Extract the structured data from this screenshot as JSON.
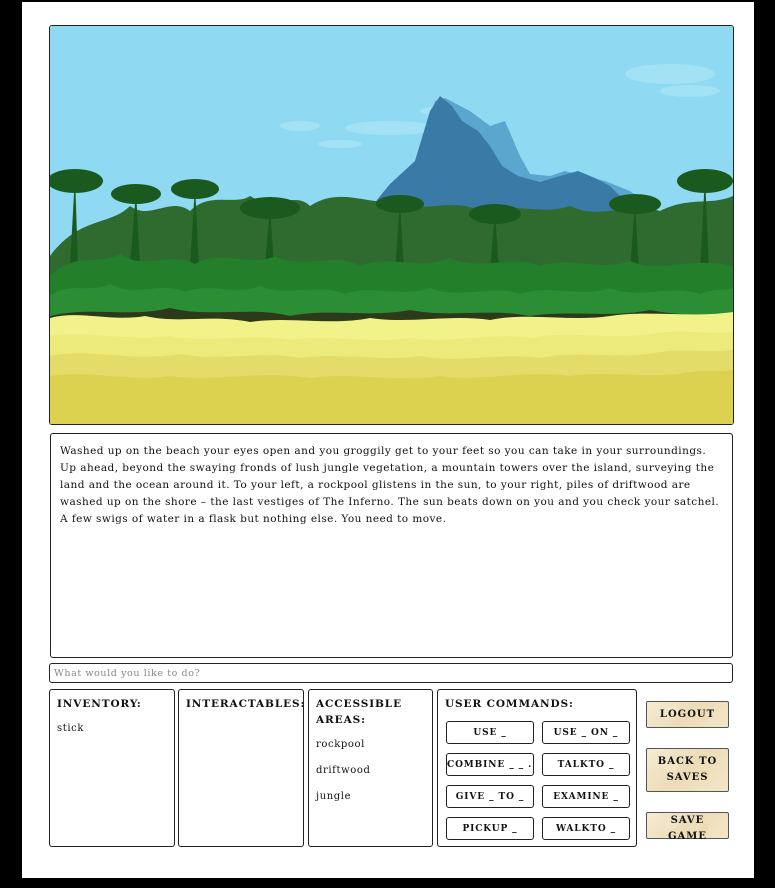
{
  "story": {
    "text": "Washed up on the beach your eyes open and you groggily get to your feet so you can take in your surroundings. Up ahead, beyond the swaying fronds of lush jungle vegetation, a mountain towers over the island, surveying the land and the ocean around it. To your left, a rockpool glistens in the sun, to your right, piles of driftwood are washed up on the shore – the last vestiges of The Inferno. The sun beats down on you and you check your satchel. A few swigs of water in a flask but nothing else. You need to move."
  },
  "command_input": {
    "placeholder": "What would you like to do?",
    "value": ""
  },
  "inventory": {
    "heading": "INVENTORY:",
    "items": [
      "stick"
    ]
  },
  "interactables": {
    "heading": "INTERACTABLES:",
    "items": []
  },
  "areas": {
    "heading": "ACCESSIBLE AREAS:",
    "items": [
      "rockpool",
      "driftwood",
      "jungle"
    ]
  },
  "user_commands": {
    "heading": "USER COMMANDS:",
    "buttons": [
      "USE _",
      "USE _ ON _",
      "COMBINE _ _ ...",
      "TALKTO _",
      "GIVE _ TO _",
      "EXAMINE _",
      "PICKUP _",
      "WALKTO _"
    ]
  },
  "side_buttons": {
    "logout": "LOGOUT",
    "back_to_saves": "BACK TO SAVES",
    "save_game": "SAVE GAME"
  },
  "colors": {
    "sky": "#8fdaf2",
    "mountain": "#3a7aa6",
    "jungle": "#1f7a2a",
    "sand": "#e8e070"
  }
}
